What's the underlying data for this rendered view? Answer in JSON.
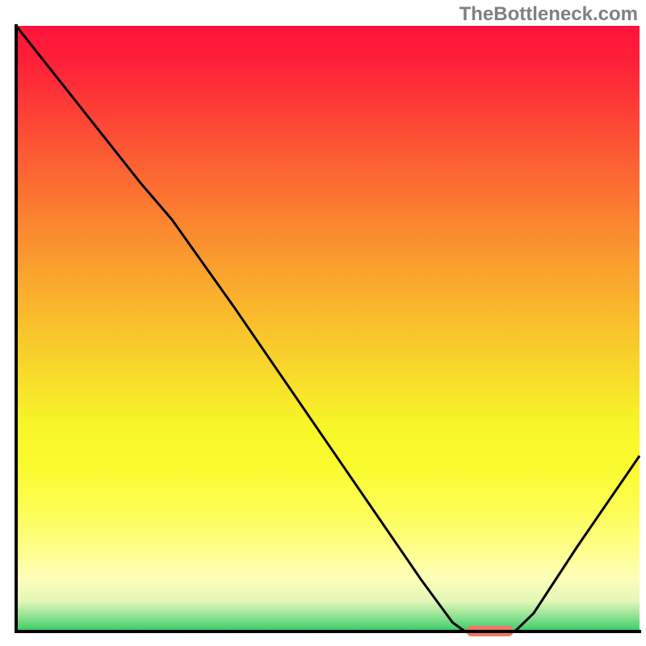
{
  "watermark": "TheBottleneck.com",
  "accent_curve_color": "#000000",
  "marker_color": "#ef766c",
  "axis_color": "#010101",
  "chart_data": {
    "type": "line",
    "title": "",
    "xlabel": "",
    "ylabel": "",
    "xlim": [
      0,
      100
    ],
    "ylim": [
      0,
      100
    ],
    "gradient_stops": [
      {
        "offset": 0.0,
        "color": "#fe133a"
      },
      {
        "offset": 0.05,
        "color": "#fe1e39"
      },
      {
        "offset": 0.1,
        "color": "#fe2f37"
      },
      {
        "offset": 0.17,
        "color": "#fd4b35"
      },
      {
        "offset": 0.24,
        "color": "#fc6533"
      },
      {
        "offset": 0.32,
        "color": "#fb8330"
      },
      {
        "offset": 0.41,
        "color": "#faa42e"
      },
      {
        "offset": 0.49,
        "color": "#f9bf2c"
      },
      {
        "offset": 0.58,
        "color": "#f8dc2a"
      },
      {
        "offset": 0.66,
        "color": "#f7f629"
      },
      {
        "offset": 0.73,
        "color": "#fafb2f"
      },
      {
        "offset": 0.8,
        "color": "#fdfd55"
      },
      {
        "offset": 0.86,
        "color": "#fefe87"
      },
      {
        "offset": 0.91,
        "color": "#fefeb8"
      },
      {
        "offset": 0.95,
        "color": "#e3f7b9"
      },
      {
        "offset": 0.975,
        "color": "#90e292"
      },
      {
        "offset": 1.0,
        "color": "#36cb66"
      }
    ],
    "curve_points_norm": [
      {
        "x": 0.0,
        "y": 100.0
      },
      {
        "x": 10.0,
        "y": 87.0
      },
      {
        "x": 20.0,
        "y": 74.0
      },
      {
        "x": 25.0,
        "y": 68.0
      },
      {
        "x": 35.0,
        "y": 53.5
      },
      {
        "x": 45.0,
        "y": 38.5
      },
      {
        "x": 55.0,
        "y": 23.5
      },
      {
        "x": 65.0,
        "y": 8.5
      },
      {
        "x": 70.0,
        "y": 1.5
      },
      {
        "x": 72.0,
        "y": 0.0
      },
      {
        "x": 80.0,
        "y": 0.0
      },
      {
        "x": 83.0,
        "y": 3.0
      },
      {
        "x": 90.0,
        "y": 14.0
      },
      {
        "x": 100.0,
        "y": 29.0
      }
    ],
    "marker": {
      "x_norm": 76.0,
      "y_norm": 0.0,
      "width_norm": 7.5
    }
  }
}
